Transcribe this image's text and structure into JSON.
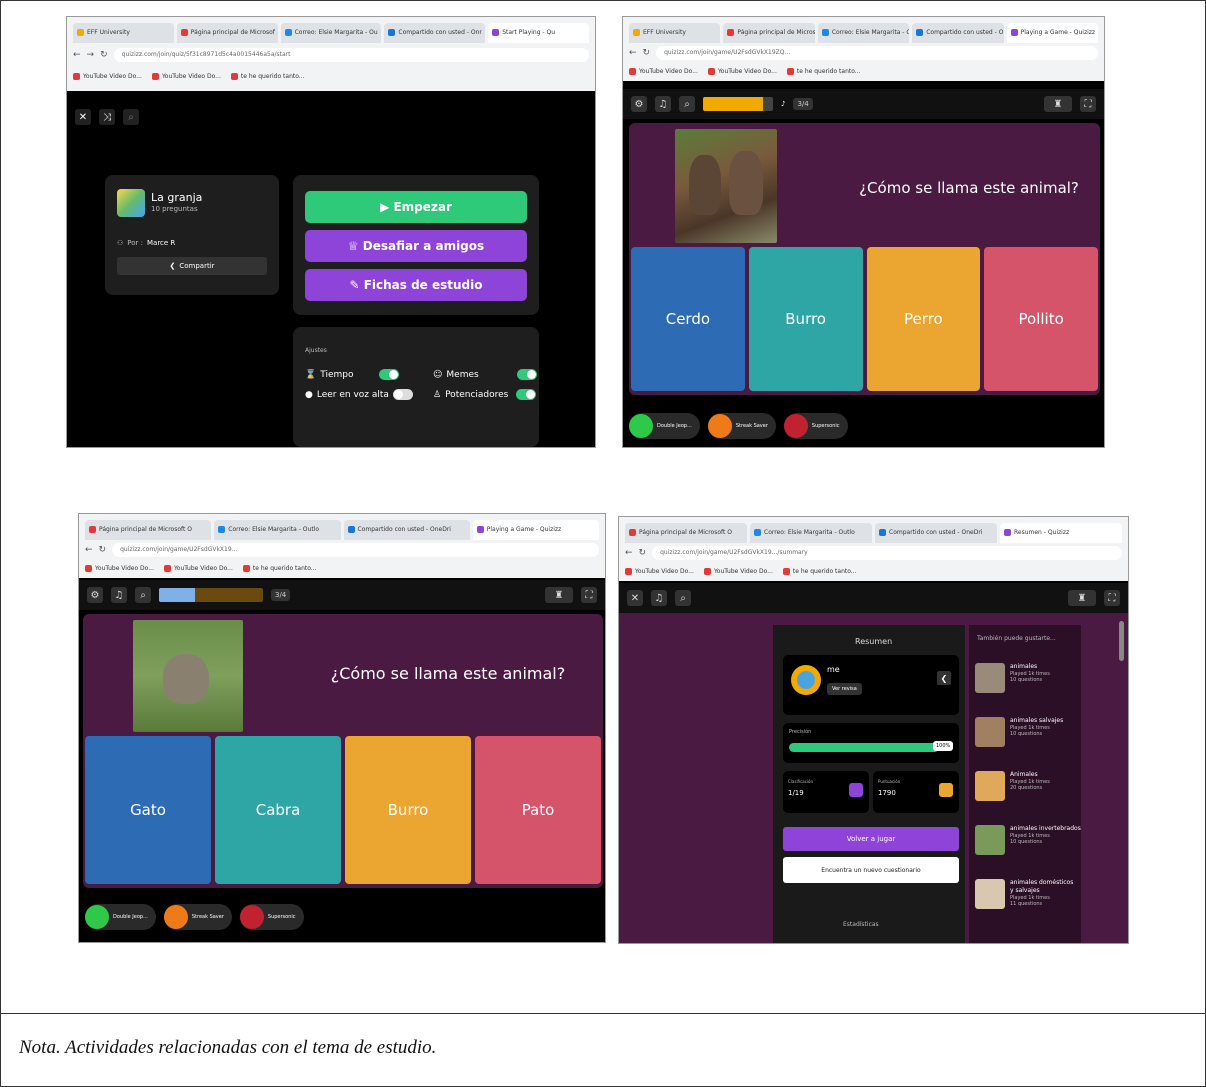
{
  "note": "Nota. Actividades relacionadas con el tema de estudio.",
  "colors": {
    "purple_bg": "#4a1a42",
    "green": "#2fc97a",
    "purple_btn": "#8e44d8",
    "blue": "#2d6cb5",
    "teal": "#2ea6a6",
    "orange": "#eaa631",
    "red": "#d55469"
  },
  "browser": {
    "bookmarks": [
      "YouTube Video Do...",
      "YouTube Video Do...",
      "te he querido tanto..."
    ]
  },
  "shot1": {
    "tabs": [
      "EFF University",
      "Página principal de Microsof",
      "Correo: Elsie Margarita - Ou",
      "Compartido con usted - Onr",
      "Start Playing - Qu"
    ],
    "url": "quizizz.com/join/quiz/5f31c8971d5c4a0015446a5a/start",
    "quiz_title": "La granja",
    "quiz_count": "10 preguntas",
    "author_prefix": "Por :",
    "author": "Marce R",
    "share": "Compartir",
    "start": "Empezar",
    "challenge": "Desafiar a amigos",
    "flashcards": "Fichas de estudio",
    "settings_title": "Ajustes",
    "settings": {
      "time": "Tiempo",
      "memes": "Memes",
      "read_aloud": "Leer en voz alta",
      "powerups": "Potenciadores"
    }
  },
  "shot2": {
    "tabs": [
      "EFF University",
      "Página principal de Microsof",
      "Correo: Elsie Margarita - Ou",
      "Compartido con usted - Onr",
      "Playing a Game - Quizizz"
    ],
    "url": "quizizz.com/join/game/U2FsdGVkX19ZQ...",
    "counter": "3/4",
    "question": "¿Cómo se llama este animal?",
    "answers": [
      "Cerdo",
      "Burro",
      "Perro",
      "Pollito"
    ],
    "powerups": [
      "Double Jeop...",
      "Streak Saver",
      "Supersonic"
    ],
    "progress": 0.85
  },
  "shot3": {
    "tabs": [
      "Página principal de Microsoft O",
      "Correo: Elsie Margarita - Outlo",
      "Compartido con usted - OneDri",
      "Playing a Game - Quizizz"
    ],
    "url": "quizizz.com/join/game/U2FsdGVkX19...",
    "counter": "3/4",
    "question": "¿Cómo se llama este animal?",
    "answers": [
      "Gato",
      "Cabra",
      "Burro",
      "Pato"
    ],
    "powerups": [
      "Double Jeop...",
      "Streak Saver",
      "Supersonic"
    ],
    "progress": 0.35
  },
  "shot4": {
    "tabs": [
      "Página principal de Microsoft O",
      "Correo: Elsie Margarita - Outlo",
      "Compartido con usted - OneDri",
      "Resumen - Quizizz"
    ],
    "url": "quizizz.com/join/game/U2FsdGVkX19.../summary",
    "summary_title": "Resumen",
    "player": "me",
    "edit": "Ver revisa",
    "accuracy_label": "Precisión",
    "accuracy_value": "100%",
    "rank_label": "Clasificación",
    "rank_value": "1/19",
    "score_label": "Puntuación",
    "score_value": "1790",
    "play_again": "Volver a jugar",
    "new_quiz": "Encuentra un nuevo cuestionario",
    "stats": "Estadísticas",
    "reco_title": "También puede gustarte...",
    "recommendations": [
      {
        "title": "animales",
        "sub1": "Played 1k times",
        "sub2": "10 questions"
      },
      {
        "title": "animales salvajes",
        "sub1": "Played 1k times",
        "sub2": "10 questions"
      },
      {
        "title": "Animales",
        "sub1": "Played 1k times",
        "sub2": "20 questions"
      },
      {
        "title": "animales invertebrados",
        "sub1": "Played 1k times",
        "sub2": "10 questions"
      },
      {
        "title": "animales domésticos y salvajes",
        "sub1": "Played 1k times",
        "sub2": "11 questions"
      }
    ]
  }
}
